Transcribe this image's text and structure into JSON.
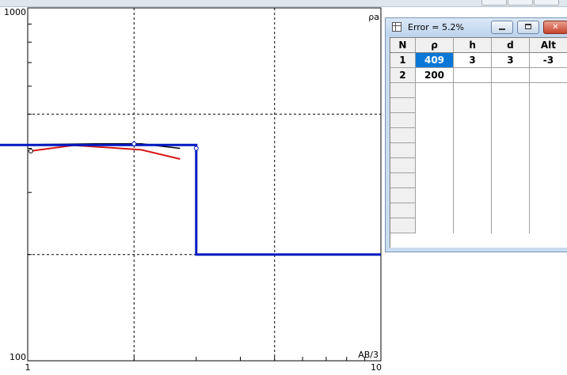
{
  "plot": {
    "corner_top_label": "ρa",
    "corner_bottom_label": "AB/3",
    "y_axis": {
      "scale": "log",
      "range": [
        100,
        1000
      ],
      "tick_labels": [
        "1000",
        "100"
      ]
    },
    "x_axis": {
      "scale": "log",
      "range": [
        1,
        10
      ],
      "tick_labels": [
        "1",
        "10"
      ]
    },
    "grid": "dashed",
    "colors": {
      "model": "#0018c0",
      "observed": "#000000",
      "calculated": "#d81818"
    }
  },
  "chart_data": {
    "type": "line",
    "xlabel": "AB/3",
    "ylabel": "ρa",
    "xlim": [
      1,
      10
    ],
    "ylim": [
      100,
      1000
    ],
    "series": [
      {
        "x": [
          0.8,
          1.55,
          2.1,
          2.7
        ],
        "y": [
          408,
          412,
          412,
          400
        ]
      },
      {
        "x": [
          1.02,
          1.35,
          2.1,
          2.7
        ],
        "y": [
          393,
          408,
          396,
          373
        ]
      },
      {
        "x": [
          0.8,
          3,
          3,
          10
        ],
        "y": [
          409,
          409,
          200,
          200
        ]
      }
    ]
  },
  "error_window": {
    "title": "Error = 5.2%",
    "columns": [
      "N",
      "ρ",
      "h",
      "d",
      "Alt"
    ],
    "rows": [
      {
        "n": "1",
        "rho": "409",
        "h": "3",
        "d": "3",
        "alt": "-3"
      },
      {
        "n": "2",
        "rho": "200",
        "h": "",
        "d": "",
        "alt": ""
      }
    ],
    "empty_rows": 10
  }
}
